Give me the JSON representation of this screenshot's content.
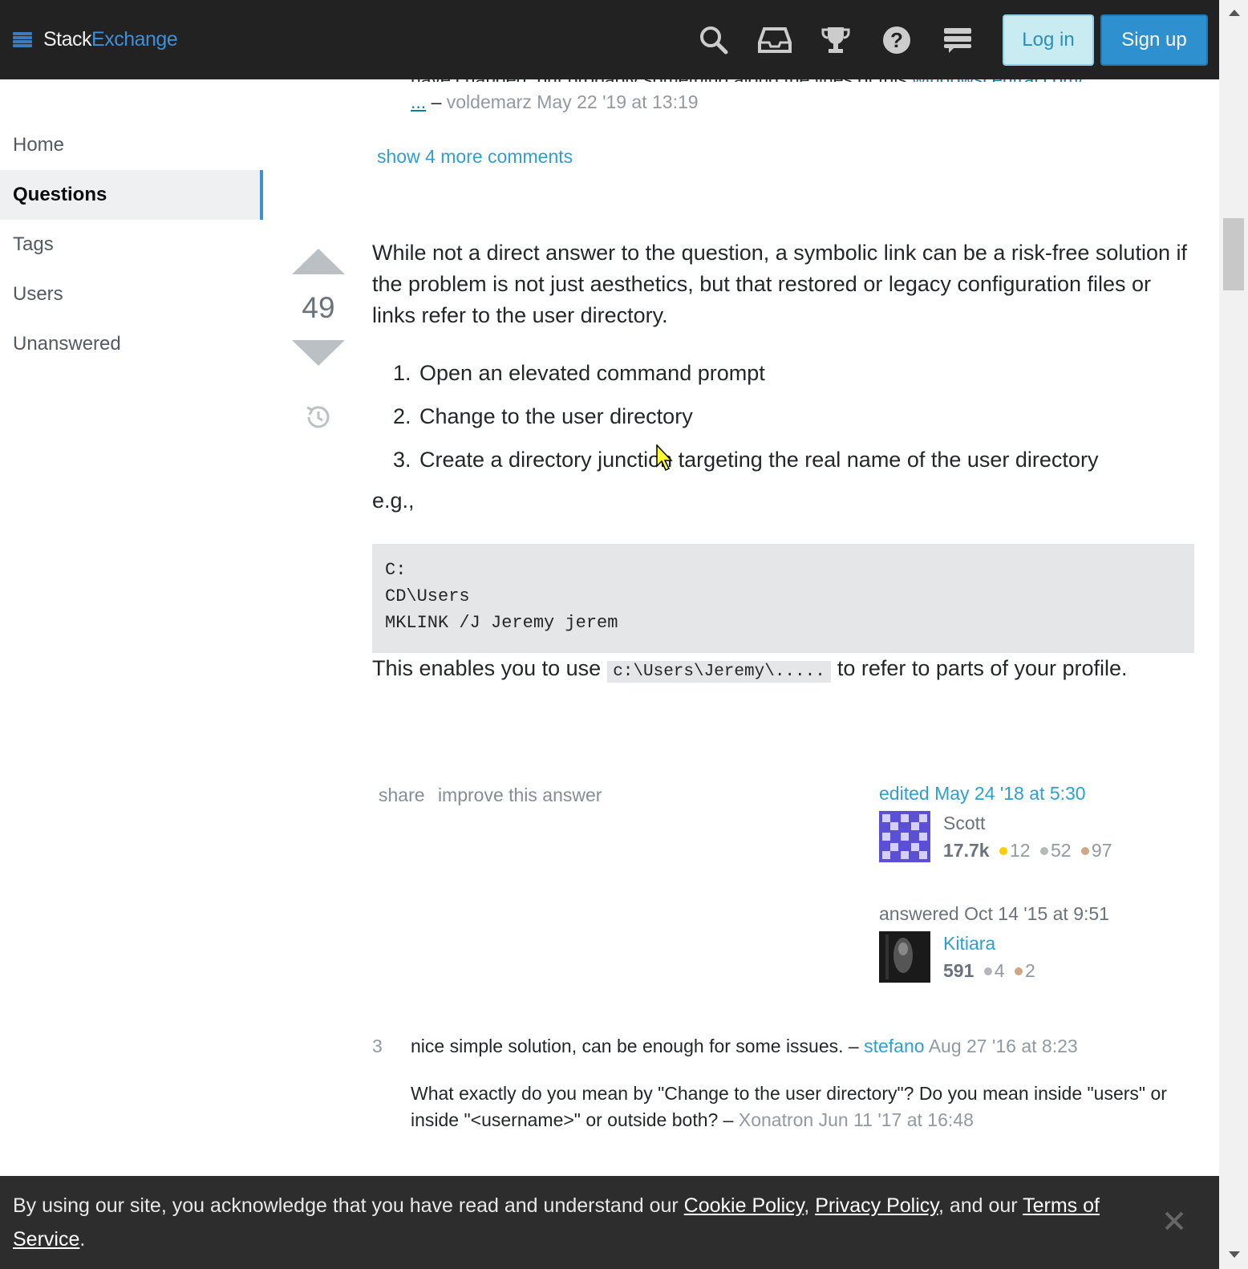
{
  "header": {
    "brand_stack": "Stack",
    "brand_exchange": "Exchange",
    "icons": [
      "search-icon",
      "inbox-icon",
      "achievements-icon",
      "help-icon",
      "site-switcher-icon"
    ],
    "login_label": "Log in",
    "signup_label": "Sign up"
  },
  "sidebar": {
    "items": [
      {
        "label": "Home"
      },
      {
        "label": "Questions"
      },
      {
        "label": "Tags"
      },
      {
        "label": "Users"
      },
      {
        "label": "Unanswered"
      }
    ]
  },
  "prev_comment": {
    "cut_text": "have changed, but probably something along the lines of this",
    "link_text": "windowscentral.com/...",
    "ellipsis": "...",
    "dash": "–",
    "user": "voldemarz",
    "date": "May 22 '19 at 13:19"
  },
  "show_more_label": "show 4 more comments",
  "answer": {
    "score": "49",
    "intro": "While not a direct answer to the question, a symbolic link can be a risk-free solution if the problem is not just aesthetics, but that restored or legacy configuration files or links refer to the user directory.",
    "steps": [
      {
        "num": "1.",
        "text": "Open an elevated command prompt"
      },
      {
        "num": "2.",
        "text": "Change to the user directory"
      },
      {
        "num": "3.",
        "text": "Create a directory junction targeting the real name of the user directory"
      }
    ],
    "eg": "e.g.,",
    "code": "C:\nCD\\Users\nMKLINK /J Jeremy jerem",
    "enables_before": "This enables you to use",
    "enables_code": "c:\\Users\\Jeremy\\.....",
    "enables_after": "to refer to parts of your profile.",
    "menu": {
      "share": "share",
      "improve": "improve this answer"
    },
    "edited": {
      "action": "edited",
      "date": "May 24 '18 at 5:30",
      "user": "Scott",
      "rep": "17.7k",
      "gold": "12",
      "silver": "52",
      "bronze": "97"
    },
    "answered": {
      "action": "answered",
      "date": "Oct 14 '15 at 9:51",
      "user": "Kitiara",
      "rep": "591",
      "silver": "4",
      "bronze": "2"
    }
  },
  "comments": [
    {
      "score": "3",
      "text": "nice simple solution, can be enough for some issues. –",
      "user": "stefano",
      "date": "Aug 27 '16 at 8:23"
    },
    {
      "score": "",
      "text": "What exactly do you mean by \"Change to the user directory\"? Do you mean inside \"users\" or inside \"<username>\" or outside both? –",
      "user": "Xonatron",
      "date": "Jun 11 '17 at 16:48"
    }
  ],
  "cookie": {
    "text1": "By using our site, you acknowledge that you have read and understand our",
    "cookie_policy": "Cookie Policy",
    "comma": ",",
    "privacy_policy": "Privacy Policy",
    "and_our": ", and our",
    "terms": "Terms of Service",
    "period": "."
  },
  "colors": {
    "accent": "#3e8fd6",
    "link": "#2f9fcf",
    "topbar": "#222222",
    "banner": "#2d2d2d"
  }
}
